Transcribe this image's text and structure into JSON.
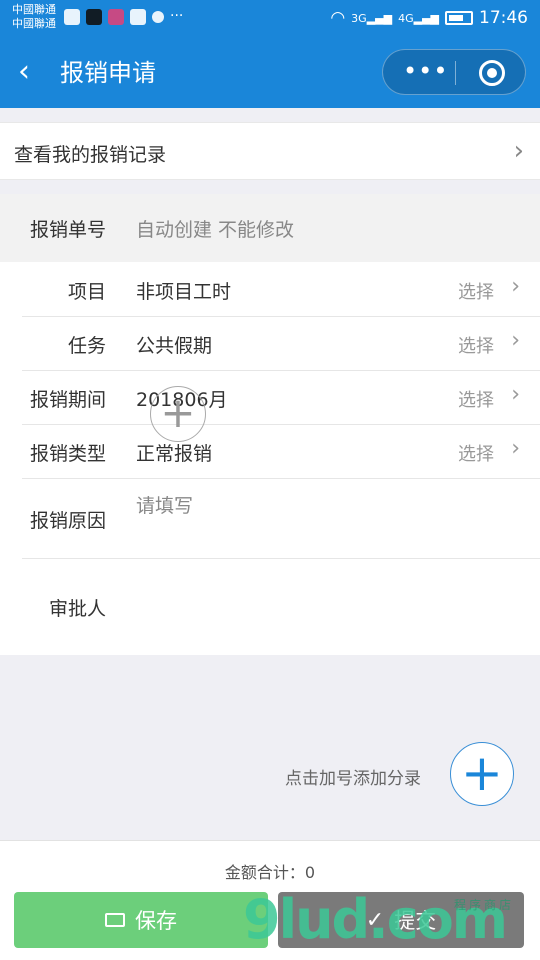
{
  "status_bar": {
    "carrier_1": "中國聯通",
    "carrier_2": "中國聯通",
    "net_3g": "3G",
    "net_4g": "4G",
    "time": "17:46"
  },
  "nav": {
    "title": "报销申请",
    "more": "•••"
  },
  "records_link": "查看我的报销记录",
  "form": {
    "id_label": "报销单号",
    "id_value": "自动创建 不能修改",
    "project_label": "项目",
    "project_value": "非项目工时",
    "task_label": "任务",
    "task_value": "公共假期",
    "period_label": "报销期间",
    "period_value": "201806月",
    "type_label": "报销类型",
    "type_value": "正常报销",
    "reason_label": "报销原因",
    "reason_placeholder": "请填写",
    "approver_label": "审批人",
    "select_text": "选择"
  },
  "entries": {
    "add_hint": "点击加号添加分录"
  },
  "footer": {
    "total": "金额合计：0",
    "save_label": "保存",
    "submit_label": "提交"
  },
  "watermark": {
    "text": "9lud.com",
    "sub": "程序商店"
  }
}
